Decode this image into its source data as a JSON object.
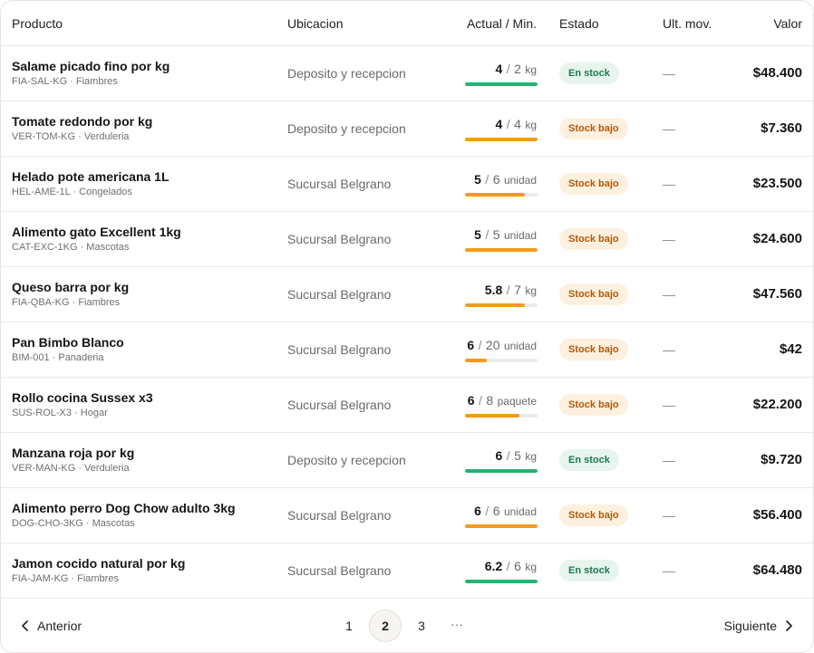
{
  "table": {
    "headers": {
      "producto": "Producto",
      "ubicacion": "Ubicacion",
      "actual_min": "Actual / Min.",
      "estado": "Estado",
      "ult_mov": "Ult. mov.",
      "valor": "Valor"
    },
    "rows": [
      {
        "name": "Salame picado fino por kg",
        "sub": "FIA-SAL-KG · Fiambres",
        "location": "Deposito y recepcion",
        "current": "4",
        "sep": "/",
        "min": "2",
        "unit": "kg",
        "level": 1.0,
        "bar_color": "#22b573",
        "status": "En stock",
        "status_kind": "ok",
        "last_move": "—",
        "value": "$48.400"
      },
      {
        "name": "Tomate redondo por kg",
        "sub": "VER-TOM-KG · Verduleria",
        "location": "Deposito y recepcion",
        "current": "4",
        "sep": "/",
        "min": "4",
        "unit": "kg",
        "level": 1.0,
        "bar_color": "#f59a1b",
        "status": "Stock bajo",
        "status_kind": "low",
        "last_move": "—",
        "value": "$7.360"
      },
      {
        "name": "Helado pote americana 1L",
        "sub": "HEL-AME-1L · Congelados",
        "location": "Sucursal Belgrano",
        "current": "5",
        "sep": "/",
        "min": "6",
        "unit": "unidad",
        "level": 0.83,
        "bar_color": "#f59a1b",
        "status": "Stock bajo",
        "status_kind": "low",
        "last_move": "—",
        "value": "$23.500"
      },
      {
        "name": "Alimento gato Excellent 1kg",
        "sub": "CAT-EXC-1KG · Mascotas",
        "location": "Sucursal Belgrano",
        "current": "5",
        "sep": "/",
        "min": "5",
        "unit": "unidad",
        "level": 1.0,
        "bar_color": "#f59a1b",
        "status": "Stock bajo",
        "status_kind": "low",
        "last_move": "—",
        "value": "$24.600"
      },
      {
        "name": "Queso barra por kg",
        "sub": "FIA-QBA-KG · Fiambres",
        "location": "Sucursal Belgrano",
        "current": "5.8",
        "sep": "/",
        "min": "7",
        "unit": "kg",
        "level": 0.83,
        "bar_color": "#f59a1b",
        "status": "Stock bajo",
        "status_kind": "low",
        "last_move": "—",
        "value": "$47.560"
      },
      {
        "name": "Pan Bimbo Blanco",
        "sub": "BIM-001 · Panaderia",
        "location": "Sucursal Belgrano",
        "current": "6",
        "sep": "/",
        "min": "20",
        "unit": "unidad",
        "level": 0.3,
        "bar_color": "#f59a1b",
        "status": "Stock bajo",
        "status_kind": "low",
        "last_move": "—",
        "value": "$42"
      },
      {
        "name": "Rollo cocina Sussex x3",
        "sub": "SUS-ROL-X3 · Hogar",
        "location": "Sucursal Belgrano",
        "current": "6",
        "sep": "/",
        "min": "8",
        "unit": "paquete",
        "level": 0.75,
        "bar_color": "#f59a1b",
        "status": "Stock bajo",
        "status_kind": "low",
        "last_move": "—",
        "value": "$22.200"
      },
      {
        "name": "Manzana roja por kg",
        "sub": "VER-MAN-KG · Verduleria",
        "location": "Deposito y recepcion",
        "current": "6",
        "sep": "/",
        "min": "5",
        "unit": "kg",
        "level": 1.0,
        "bar_color": "#22b573",
        "status": "En stock",
        "status_kind": "ok",
        "last_move": "—",
        "value": "$9.720"
      },
      {
        "name": "Alimento perro Dog Chow adulto 3kg",
        "sub": "DOG-CHO-3KG · Mascotas",
        "location": "Sucursal Belgrano",
        "current": "6",
        "sep": "/",
        "min": "6",
        "unit": "unidad",
        "level": 1.0,
        "bar_color": "#f59a1b",
        "status": "Stock bajo",
        "status_kind": "low",
        "last_move": "—",
        "value": "$56.400"
      },
      {
        "name": "Jamon cocido natural por kg",
        "sub": "FIA-JAM-KG · Fiambres",
        "location": "Sucursal Belgrano",
        "current": "6.2",
        "sep": "/",
        "min": "6",
        "unit": "kg",
        "level": 1.0,
        "bar_color": "#22b573",
        "status": "En stock",
        "status_kind": "ok",
        "last_move": "—",
        "value": "$64.480"
      }
    ]
  },
  "pagination": {
    "prev_label": "Anterior",
    "next_label": "Siguiente",
    "pages": [
      "1",
      "2",
      "3"
    ],
    "current_page": "2",
    "ellipsis": "···",
    "prev_icon": "chevron-left-icon",
    "next_icon": "chevron-right-icon"
  }
}
